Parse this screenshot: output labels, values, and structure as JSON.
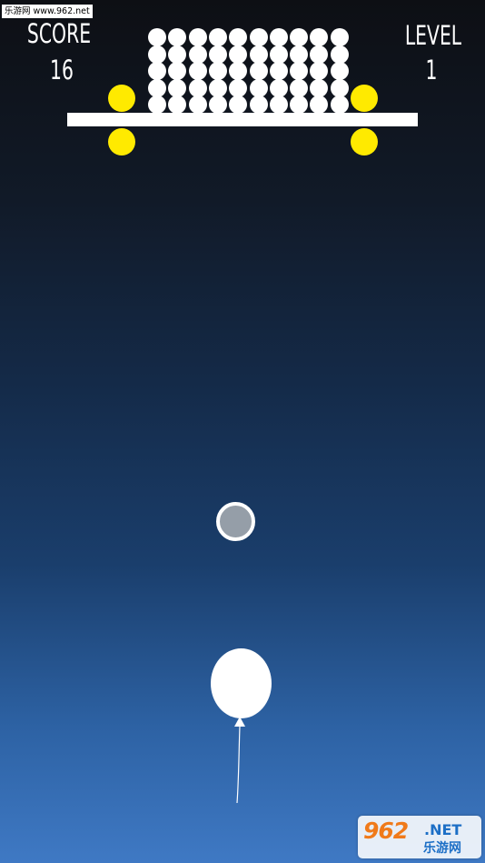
{
  "watermark_top": "乐游网 www.962.net",
  "hud": {
    "score_label": "SCORE",
    "score_value": "16",
    "level_label": "LEVEL",
    "level_value": "1"
  },
  "logo": {
    "number": "962",
    "suffix": ".NET",
    "chinese": "乐游网"
  },
  "colors": {
    "sky_top": "#0d0f14",
    "sky_bottom": "#3f79c4",
    "peg": "#ffea00",
    "shield_fill": "#959ea8",
    "balloon": "#ffffff"
  },
  "ball_grid": {
    "columns": 10,
    "rows": 5
  }
}
